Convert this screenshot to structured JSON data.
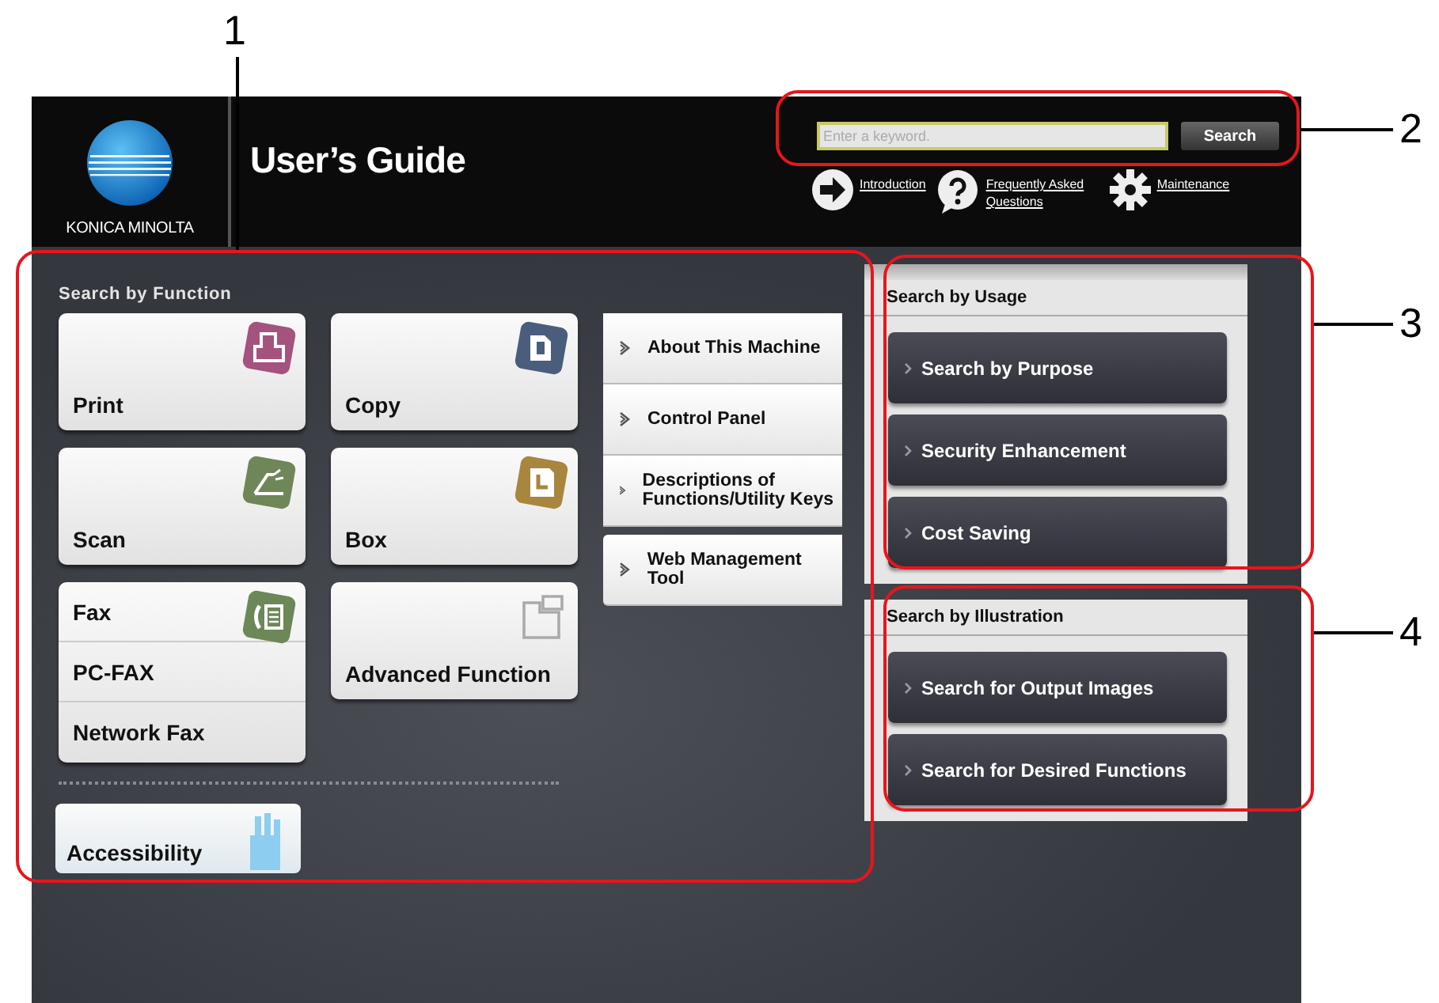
{
  "header": {
    "logo_text": "KONICA MINOLTA",
    "title": "User’s Guide",
    "search": {
      "placeholder": "Enter a keyword.",
      "button": "Search"
    },
    "links": [
      {
        "kind": "arrow",
        "label": "Introduction"
      },
      {
        "kind": "question",
        "label": "Frequently Asked Questions"
      },
      {
        "kind": "gear",
        "label": "Maintenance"
      }
    ]
  },
  "function_panel": {
    "heading": "Search by Function",
    "tiles": [
      {
        "kind": "print",
        "labels": [
          "Print"
        ]
      },
      {
        "kind": "copy",
        "labels": [
          "Copy"
        ]
      },
      {
        "kind": "scan",
        "labels": [
          "Scan"
        ]
      },
      {
        "kind": "box",
        "labels": [
          "Box"
        ]
      },
      {
        "kind": "fax",
        "labels": [
          "Fax",
          "PC-FAX",
          "Network Fax"
        ]
      },
      {
        "kind": "advanced",
        "labels": [
          "Advanced Function"
        ]
      }
    ],
    "links": [
      "About This Machine",
      "Control Panel",
      "Descriptions of Functions/Utility Keys",
      "Web Management Tool"
    ],
    "accessibility": "Accessibility"
  },
  "usage_panel": {
    "heading": "Search by Usage",
    "buttons": [
      "Search by Purpose",
      "Security Enhancement",
      "Cost Saving"
    ]
  },
  "illustration_panel": {
    "heading": "Search by Illustration",
    "buttons": [
      "Search for Output Images",
      "Search for Desired Functions"
    ]
  },
  "callouts": [
    {
      "label": "1"
    },
    {
      "label": "2"
    },
    {
      "label": "3"
    },
    {
      "label": "4"
    }
  ]
}
